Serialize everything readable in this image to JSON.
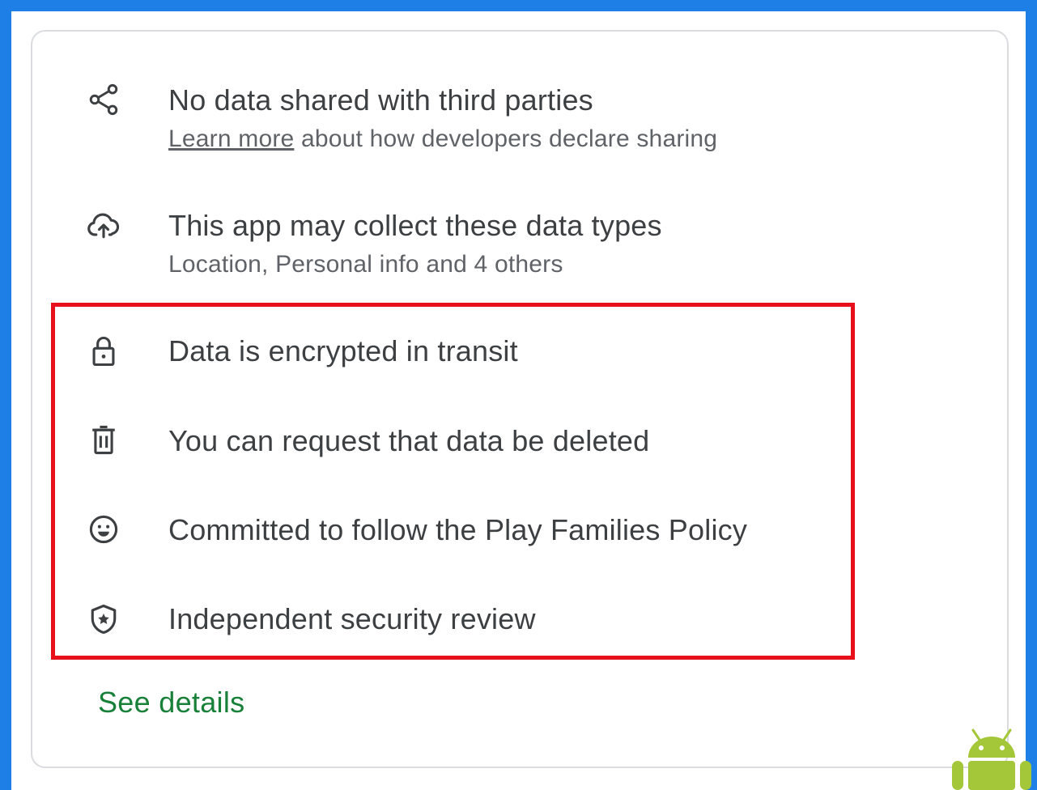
{
  "rows": [
    {
      "icon": "share-icon",
      "title": "No data shared with third parties",
      "sub_link": "Learn more",
      "sub_text": " about how developers declare sharing"
    },
    {
      "icon": "cloud-upload-icon",
      "title": "This app may collect these data types",
      "sub_text": "Location, Personal info and 4 others"
    },
    {
      "icon": "lock-icon",
      "title": "Data is encrypted in transit"
    },
    {
      "icon": "trash-icon",
      "title": "You can request that data be deleted"
    },
    {
      "icon": "smiley-icon",
      "title": "Committed to follow the Play Families Policy"
    },
    {
      "icon": "shield-star-icon",
      "title": "Independent security review"
    }
  ],
  "see_details_label": "See details",
  "colors": {
    "frame_border": "#1e7fe6",
    "highlight": "#e8101a",
    "link_green": "#188038",
    "text_primary": "#3c4043",
    "text_secondary": "#5f6368"
  }
}
